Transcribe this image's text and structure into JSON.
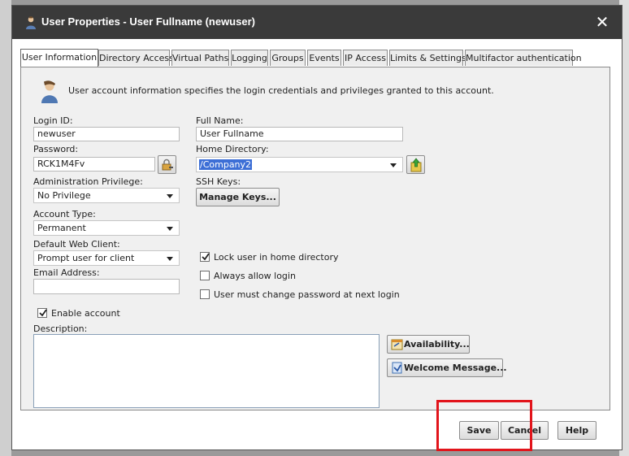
{
  "window": {
    "title": "User Properties - User Fullname (newuser)",
    "close_glyph": "✕"
  },
  "tabs": [
    {
      "label": "User Information",
      "active": true
    },
    {
      "label": "Directory Access"
    },
    {
      "label": "Virtual Paths"
    },
    {
      "label": "Logging"
    },
    {
      "label": "Groups"
    },
    {
      "label": "Events"
    },
    {
      "label": "IP Access"
    },
    {
      "label": "Limits & Settings"
    },
    {
      "label": "Multifactor authentication"
    }
  ],
  "info_text": "User account information specifies the login credentials and privileges granted to this account.",
  "form": {
    "login_id_label": "Login ID:",
    "login_id_value": "newuser",
    "full_name_label": "Full Name:",
    "full_name_value": "User Fullname",
    "password_label": "Password:",
    "password_value": "RCK1M4Fv",
    "home_dir_label": "Home Directory:",
    "home_dir_value": "/Company2",
    "admin_priv_label": "Administration Privilege:",
    "admin_priv_value": "No Privilege",
    "ssh_keys_label": "SSH Keys:",
    "manage_keys_label": "Manage Keys...",
    "account_type_label": "Account Type:",
    "account_type_value": "Permanent",
    "web_client_label": "Default Web Client:",
    "web_client_value": "Prompt user for client",
    "email_label": "Email Address:",
    "email_value": "",
    "lock_home_label": "Lock user in home directory",
    "always_login_label": "Always allow login",
    "must_change_label": "User must change password at next login",
    "enable_account_label": "Enable account",
    "description_label": "Description:",
    "description_value": "",
    "availability_label": "Availability...",
    "welcome_label": "Welcome Message..."
  },
  "checkboxes": {
    "lock_home": true,
    "always_login": false,
    "must_change": false,
    "enable_account": true
  },
  "footer": {
    "save_label": "Save",
    "cancel_label": "Cancel",
    "help_label": "Help"
  },
  "colors": {
    "titlebar": "#3a3a3a",
    "highlight": "#3d6fd6",
    "annotation": "#e2141b"
  }
}
